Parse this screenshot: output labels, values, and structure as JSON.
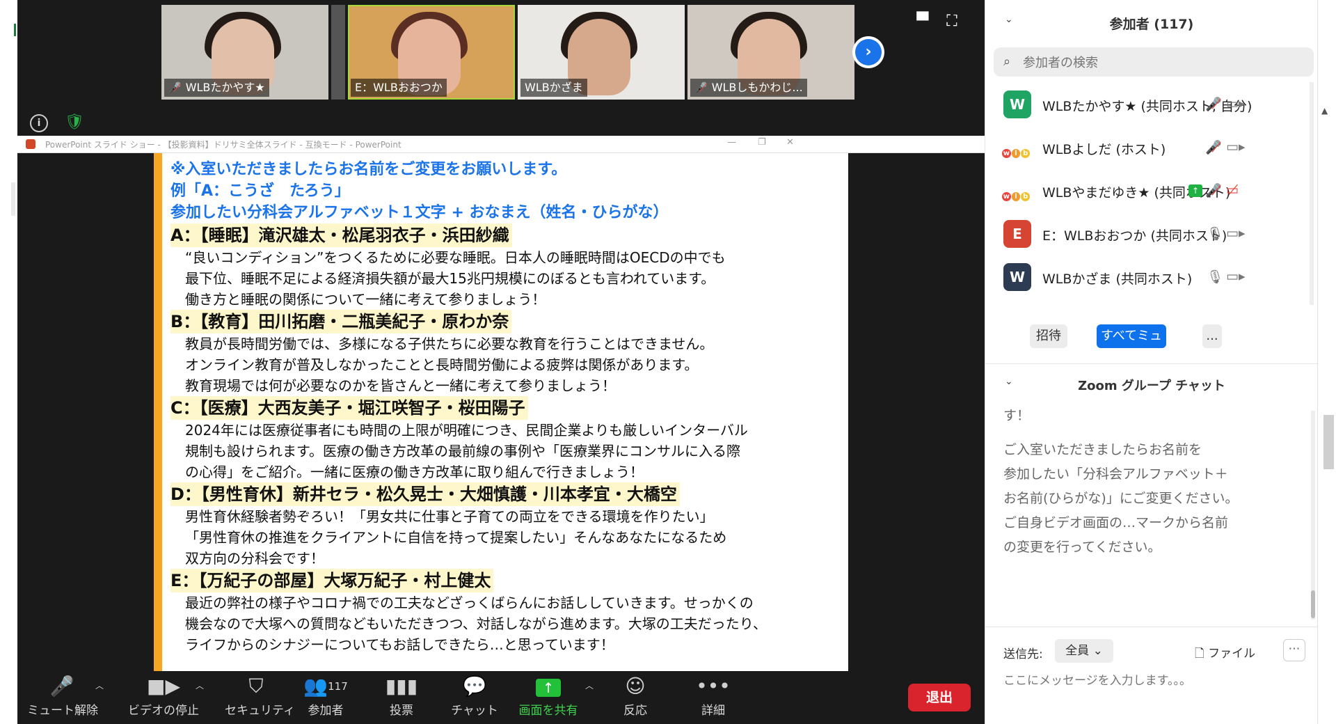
{
  "participants_video": [
    {
      "name": "WLBたかやす★",
      "muted": true
    },
    {
      "name": "E：WLBおおつか",
      "muted": false
    },
    {
      "name": "WLBかざま",
      "muted": false
    },
    {
      "name": "WLBしもかわじ...",
      "muted": true
    }
  ],
  "ppt": {
    "window_title": "PowerPoint スライド ショー - 【投影資料】ドリサミ全体スライド - 互換モード - PowerPoint",
    "blue_lines": [
      "※入室いただきましたらお名前をご変更をお願いします。",
      "例「A：こうざ　たろう」",
      "参加したい分科会アルファベット１文字 + おなまえ（姓名・ひらがな）"
    ],
    "sections": [
      {
        "head": "A：【睡眠】滝沢雄太・松尾羽衣子・浜田紗織",
        "lines": [
          "“良いコンディション”をつくるために必要な睡眠。日本人の睡眠時間はOECDの中でも",
          "最下位、睡眠不足による経済損失額が最大15兆円規模にのぼるとも言われています。",
          "働き方と睡眠の関係について一緒に考えて参りましょう！"
        ]
      },
      {
        "head": "B：【教育】田川拓磨・二瓶美紀子・原わか奈",
        "lines": [
          "教員が長時間労働では、多様になる子供たちに必要な教育を行うことはできません。",
          "オンライン教育が普及しなかったことと長時間労働による疲弊は関係があります。",
          "教育現場では何が必要なのかを皆さんと一緒に考えて参りましょう！"
        ]
      },
      {
        "head": "C：【医療】大西友美子・堀江咲智子・桜田陽子",
        "lines": [
          "2024年には医療従事者にも時間の上限が明確につき、民間企業よりも厳しいインターバル",
          "規制も設けられます。医療の働き方改革の最前線の事例や「医療業界にコンサルに入る際",
          "の心得」をご紹介。一緒に医療の働き方改革に取り組んで行きましょう！"
        ]
      },
      {
        "head": "D：【男性育休】新井セラ・松久晃士・大畑慎護・川本孝宜・大橋空",
        "lines": [
          "男性育休経験者勢ぞろい！「男女共に仕事と子育ての両立をできる環境を作りたい」",
          "「男性育休の推進をクライアントに自信を持って提案したい」そんなあなたになるため",
          "双方向の分科会です！"
        ]
      },
      {
        "head": "E：【万紀子の部屋】大塚万紀子・村上健太",
        "lines": [
          "最近の弊社の様子やコロナ禍での工夫などざっくばらんにお話ししていきます。せっかくの",
          "機会なので大塚への質問などもいただきつつ、対話しながら進めます。大塚の工夫だったり、",
          "ライフからのシナジーについてもお話しできたら…と思っています！"
        ]
      }
    ]
  },
  "toolbar": {
    "unmute": "ミュート解除",
    "stop_video": "ビデオの停止",
    "security": "セキュリティ",
    "participants": "参加者",
    "participants_count": "117",
    "poll": "投票",
    "chat": "チャット",
    "share": "画面を共有",
    "reactions": "反応",
    "more": "詳細",
    "leave": "退出"
  },
  "panel": {
    "title": "参加者 (117)",
    "search_placeholder": "参加者の検索",
    "list": [
      {
        "avatar": "W",
        "avatar_color": "#1fa463",
        "name": "WLBたかやす★ (共同ホスト, 自分)",
        "mic": "muted",
        "video": "on"
      },
      {
        "avatar": "logo",
        "name": "WLBよしだ (ホスト)",
        "mic": "muted",
        "video": "on"
      },
      {
        "avatar": "logo",
        "name": "WLBやまだゆき★ (共同ホスト)",
        "mic": "muted",
        "video": "off",
        "sharing": true
      },
      {
        "avatar": "E",
        "avatar_color": "#d64534",
        "name": "E：WLBおおつか (共同ホスト)",
        "mic": "on",
        "video": "on"
      },
      {
        "avatar": "W",
        "avatar_color": "#2d3c52",
        "name": "WLBかざま (共同ホスト)",
        "mic": "on",
        "video": "on"
      }
    ],
    "invite": "招待",
    "mute_all": "すべてミュート",
    "more": "...",
    "chat_title": "Zoom グループ チャット",
    "chat_cut": "す！",
    "chat_lines": [
      "ご入室いただきましたらお名前を",
      "参加したい「分科会アルファベット＋",
      "お名前(ひらがな)」にご変更ください。",
      "ご自身ビデオ画面の…マークから名前",
      "の変更を行ってください。"
    ],
    "send_to_label": "送信先:",
    "send_to_value": "全員",
    "file_label": "ファイル",
    "message_placeholder": "ここにメッセージを入力します。。。"
  }
}
